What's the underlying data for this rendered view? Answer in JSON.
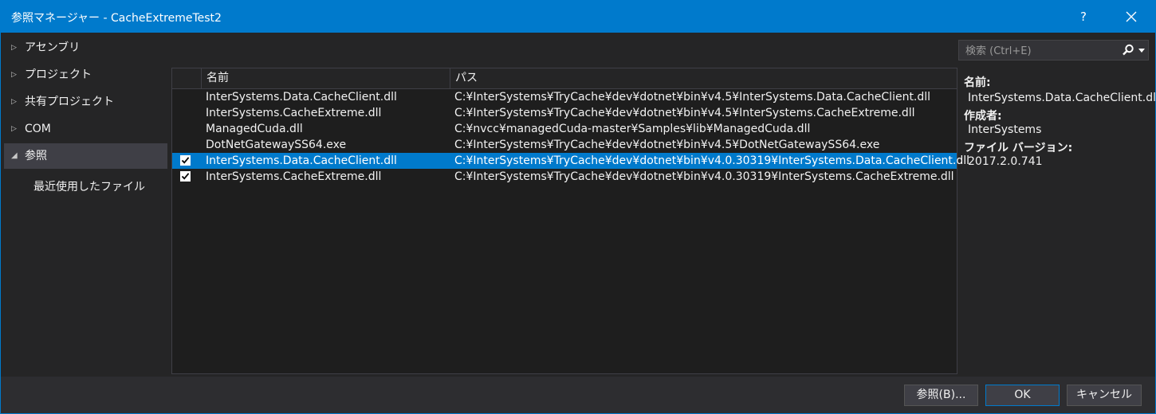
{
  "window": {
    "title": "参照マネージャー - CacheExtremeTest2",
    "help_label": "?"
  },
  "nav": {
    "items": [
      {
        "label": "アセンブリ",
        "expanded": false
      },
      {
        "label": "プロジェクト",
        "expanded": false
      },
      {
        "label": "共有プロジェクト",
        "expanded": false
      },
      {
        "label": "COM",
        "expanded": false
      },
      {
        "label": "参照",
        "expanded": true,
        "selected": true
      },
      {
        "label": "最近使用したファイル"
      }
    ]
  },
  "search": {
    "placeholder": "検索 (Ctrl+E)"
  },
  "list": {
    "columns": [
      "名前",
      "パス"
    ],
    "rows": [
      {
        "checked": false,
        "selected": false,
        "name": "InterSystems.Data.CacheClient.dll",
        "path": "C:¥InterSystems¥TryCache¥dev¥dotnet¥bin¥v4.5¥InterSystems.Data.CacheClient.dll"
      },
      {
        "checked": false,
        "selected": false,
        "name": "InterSystems.CacheExtreme.dll",
        "path": "C:¥InterSystems¥TryCache¥dev¥dotnet¥bin¥v4.5¥InterSystems.CacheExtreme.dll"
      },
      {
        "checked": false,
        "selected": false,
        "name": "ManagedCuda.dll",
        "path": "C:¥nvcc¥managedCuda-master¥Samples¥lib¥ManagedCuda.dll"
      },
      {
        "checked": false,
        "selected": false,
        "name": "DotNetGatewaySS64.exe",
        "path": "C:¥InterSystems¥TryCache¥dev¥dotnet¥bin¥v4.5¥DotNetGatewaySS64.exe"
      },
      {
        "checked": true,
        "selected": true,
        "name": "InterSystems.Data.CacheClient.dll",
        "path": "C:¥InterSystems¥TryCache¥dev¥dotnet¥bin¥v4.0.30319¥InterSystems.Data.CacheClient.dll"
      },
      {
        "checked": true,
        "selected": false,
        "name": "InterSystems.CacheExtreme.dll",
        "path": "C:¥InterSystems¥TryCache¥dev¥dotnet¥bin¥v4.0.30319¥InterSystems.CacheExtreme.dll"
      }
    ]
  },
  "details": {
    "name_label": "名前:",
    "name_value": "InterSystems.Data.CacheClient.dll",
    "author_label": "作成者:",
    "author_value": "InterSystems",
    "version_label": "ファイル バージョン:",
    "version_value": "2017.2.0.741"
  },
  "buttons": {
    "browse": "参照(B)...",
    "ok": "OK",
    "cancel": "キャンセル"
  },
  "colors": {
    "accent": "#007acc",
    "background": "#252526",
    "list_background": "#1e1e1e"
  }
}
